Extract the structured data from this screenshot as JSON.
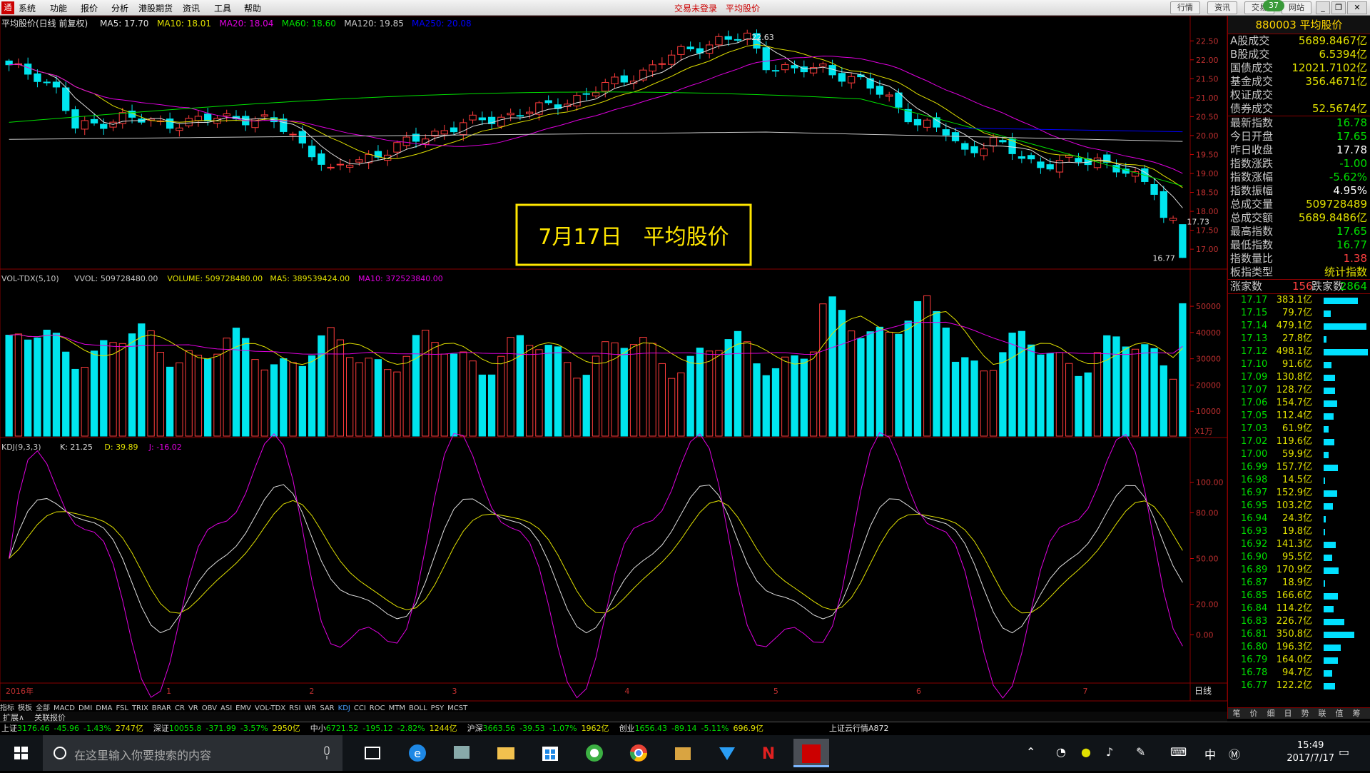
{
  "menubar": {
    "items": [
      "系统",
      "功能",
      "报价",
      "分析",
      "港股期货",
      "资讯",
      "工具",
      "帮助"
    ],
    "center": "交易未登录　平均股价",
    "right_buttons": [
      "行情",
      "资讯",
      "交易",
      "网站"
    ],
    "badge": "37"
  },
  "kline": {
    "info_title": "平均股价(日线 前复权)",
    "ma_labels": [
      {
        "text": "MA5: 17.70",
        "color": "#e0e0e0"
      },
      {
        "text": "MA10: 18.01",
        "color": "#e0e000"
      },
      {
        "text": "MA20: 18.04",
        "color": "#e000e0"
      },
      {
        "text": "MA60: 18.60",
        "color": "#00e000"
      },
      {
        "text": "MA120: 19.85",
        "color": "#c8c8c8"
      },
      {
        "text": "MA250: 20.08",
        "color": "#0000ff"
      }
    ],
    "high_label": "22.63",
    "low_label": "16.77",
    "last_label": "17.73",
    "y_ticks": [
      "22.50",
      "22.00",
      "21.50",
      "21.00",
      "20.50",
      "20.00",
      "19.50",
      "19.00",
      "18.50",
      "18.00",
      "17.50",
      "17.00"
    ],
    "annotation": "7月17日　平均股价"
  },
  "volume": {
    "label_name": "VOL-TDX(5,10)",
    "labels": [
      {
        "text": "VVOL: 509728480.00",
        "color": "#c8c8c8"
      },
      {
        "text": "VOLUME: 509728480.00",
        "color": "#e0e000"
      },
      {
        "text": "MA5: 389539424.00",
        "color": "#e0e000"
      },
      {
        "text": "MA10: 372523840.00",
        "color": "#e000e0"
      }
    ],
    "y_ticks": [
      "50000",
      "40000",
      "30000",
      "20000",
      "10000"
    ],
    "unit": "X1万"
  },
  "kdj": {
    "label_name": "KDJ(9,3,3)",
    "labels": [
      {
        "text": "K: 21.25",
        "color": "#e0e0e0"
      },
      {
        "text": "D: 39.89",
        "color": "#e0e000"
      },
      {
        "text": "J: -16.02",
        "color": "#e000e0"
      }
    ],
    "y_ticks": [
      "100.00",
      "80.00",
      "50.00",
      "20.00",
      "0.00"
    ]
  },
  "timeaxis": {
    "labels": [
      "2016年",
      "1",
      "2",
      "3",
      "4",
      "5",
      "6",
      "7"
    ],
    "period": "日线"
  },
  "indicators": [
    "指标",
    "模板",
    "全部",
    "MACD",
    "DMI",
    "DMA",
    "FSL",
    "TRIX",
    "BRAR",
    "CR",
    "VR",
    "OBV",
    "ASI",
    "EMV",
    "VOL-TDX",
    "RSI",
    "WR",
    "SAR",
    "KDJ",
    "CCI",
    "ROC",
    "MTM",
    "BOLL",
    "PSY",
    "MCST"
  ],
  "expand": [
    "扩展∧",
    "关联报价"
  ],
  "rightpanel": {
    "title": "880003 平均股价",
    "rows1": [
      {
        "l": "A股成交",
        "v": "5689.8467亿",
        "c": "#e0e000"
      },
      {
        "l": "B股成交",
        "v": "6.5394亿",
        "c": "#e0e000"
      },
      {
        "l": "国债成交",
        "v": "12021.7102亿",
        "c": "#e0e000"
      },
      {
        "l": "基金成交",
        "v": "356.4671亿",
        "c": "#e0e000"
      },
      {
        "l": "权证成交",
        "v": "",
        "c": "#e0e000"
      },
      {
        "l": "债券成交",
        "v": "52.5674亿",
        "c": "#e0e000"
      }
    ],
    "rows2": [
      {
        "l": "最新指数",
        "v": "16.78",
        "c": "#00e000"
      },
      {
        "l": "今日开盘",
        "v": "17.65",
        "c": "#00e000"
      },
      {
        "l": "昨日收盘",
        "v": "17.78",
        "c": "#ffffff"
      },
      {
        "l": "指数涨跌",
        "v": "-1.00",
        "c": "#00e000"
      },
      {
        "l": "指数涨幅",
        "v": "-5.62%",
        "c": "#00e000"
      },
      {
        "l": "指数振幅",
        "v": "4.95%",
        "c": "#ffffff"
      },
      {
        "l": "总成交量",
        "v": "509728489",
        "c": "#e0e000"
      },
      {
        "l": "总成交额",
        "v": "5689.8486亿",
        "c": "#e0e000"
      },
      {
        "l": "最高指数",
        "v": "17.65",
        "c": "#00e000"
      },
      {
        "l": "最低指数",
        "v": "16.77",
        "c": "#00e000"
      },
      {
        "l": "指数量比",
        "v": "1.38",
        "c": "#ff4040"
      },
      {
        "l": "板指类型",
        "v": "统计指数",
        "c": "#e0e000"
      }
    ],
    "updown": {
      "up_label": "涨家数",
      "up": "156",
      "down_label": "跌家数",
      "down": "2864"
    },
    "ladder": [
      {
        "p": "17.17",
        "a": "383.1亿",
        "w": 0.77
      },
      {
        "p": "17.15",
        "a": "79.7亿",
        "w": 0.16
      },
      {
        "p": "17.14",
        "a": "479.1亿",
        "w": 0.96
      },
      {
        "p": "17.13",
        "a": "27.8亿",
        "w": 0.06
      },
      {
        "p": "17.12",
        "a": "498.1亿",
        "w": 1.0
      },
      {
        "p": "17.10",
        "a": "91.6亿",
        "w": 0.18
      },
      {
        "p": "17.09",
        "a": "130.8亿",
        "w": 0.26
      },
      {
        "p": "17.07",
        "a": "128.7亿",
        "w": 0.26
      },
      {
        "p": "17.06",
        "a": "154.7亿",
        "w": 0.31
      },
      {
        "p": "17.05",
        "a": "112.4亿",
        "w": 0.23
      },
      {
        "p": "17.03",
        "a": "61.9亿",
        "w": 0.12
      },
      {
        "p": "17.02",
        "a": "119.6亿",
        "w": 0.24
      },
      {
        "p": "17.00",
        "a": "59.9亿",
        "w": 0.12
      },
      {
        "p": "16.99",
        "a": "157.7亿",
        "w": 0.32
      },
      {
        "p": "16.98",
        "a": "14.5亿",
        "w": 0.03
      },
      {
        "p": "16.97",
        "a": "152.9亿",
        "w": 0.31
      },
      {
        "p": "16.95",
        "a": "103.2亿",
        "w": 0.21
      },
      {
        "p": "16.94",
        "a": "24.3亿",
        "w": 0.05
      },
      {
        "p": "16.93",
        "a": "19.8亿",
        "w": 0.04
      },
      {
        "p": "16.92",
        "a": "141.3亿",
        "w": 0.28
      },
      {
        "p": "16.90",
        "a": "95.5亿",
        "w": 0.19
      },
      {
        "p": "16.89",
        "a": "170.9亿",
        "w": 0.34
      },
      {
        "p": "16.87",
        "a": "18.9亿",
        "w": 0.04
      },
      {
        "p": "16.85",
        "a": "166.6亿",
        "w": 0.33
      },
      {
        "p": "16.84",
        "a": "114.2亿",
        "w": 0.23
      },
      {
        "p": "16.83",
        "a": "226.7亿",
        "w": 0.46
      },
      {
        "p": "16.81",
        "a": "350.8亿",
        "w": 0.7
      },
      {
        "p": "16.80",
        "a": "196.3亿",
        "w": 0.39
      },
      {
        "p": "16.79",
        "a": "164.0亿",
        "w": 0.33
      },
      {
        "p": "16.78",
        "a": "94.7亿",
        "w": 0.19
      },
      {
        "p": "16.77",
        "a": "122.2亿",
        "w": 0.25
      }
    ],
    "tabs": [
      "笔",
      "价",
      "细",
      "日",
      "势",
      "联",
      "值",
      "筹"
    ]
  },
  "statusbar": [
    {
      "name": "上证",
      "val": "3176.46",
      "chg": "-45.96",
      "pct": "-1.43%",
      "amt": "2747亿"
    },
    {
      "name": "深证",
      "val": "10055.8",
      "chg": "-371.99",
      "pct": "-3.57%",
      "amt": "2950亿"
    },
    {
      "name": "中小",
      "val": "6721.52",
      "chg": "-195.12",
      "pct": "-2.82%",
      "amt": "1244亿"
    },
    {
      "name": "沪深",
      "val": "3663.56",
      "chg": "-39.53",
      "pct": "-1.07%",
      "amt": "1962亿"
    },
    {
      "name": "创业",
      "val": "1656.43",
      "chg": "-89.14",
      "pct": "-5.11%",
      "amt": "696.9亿"
    }
  ],
  "status_extra": "上证云行情A872",
  "taskbar": {
    "search_placeholder": "在这里输入你要搜索的内容",
    "time": "15:49",
    "date": "2017/7/17",
    "ime": "中"
  },
  "colors": {
    "up": "#ff3c3c",
    "down": "#00e5ee",
    "ma5": "#e0e0e0",
    "ma10": "#e0e000",
    "ma20": "#e000e0",
    "ma60": "#00e000",
    "ma120": "#c8c8c8",
    "ma250": "#0000ff"
  }
}
